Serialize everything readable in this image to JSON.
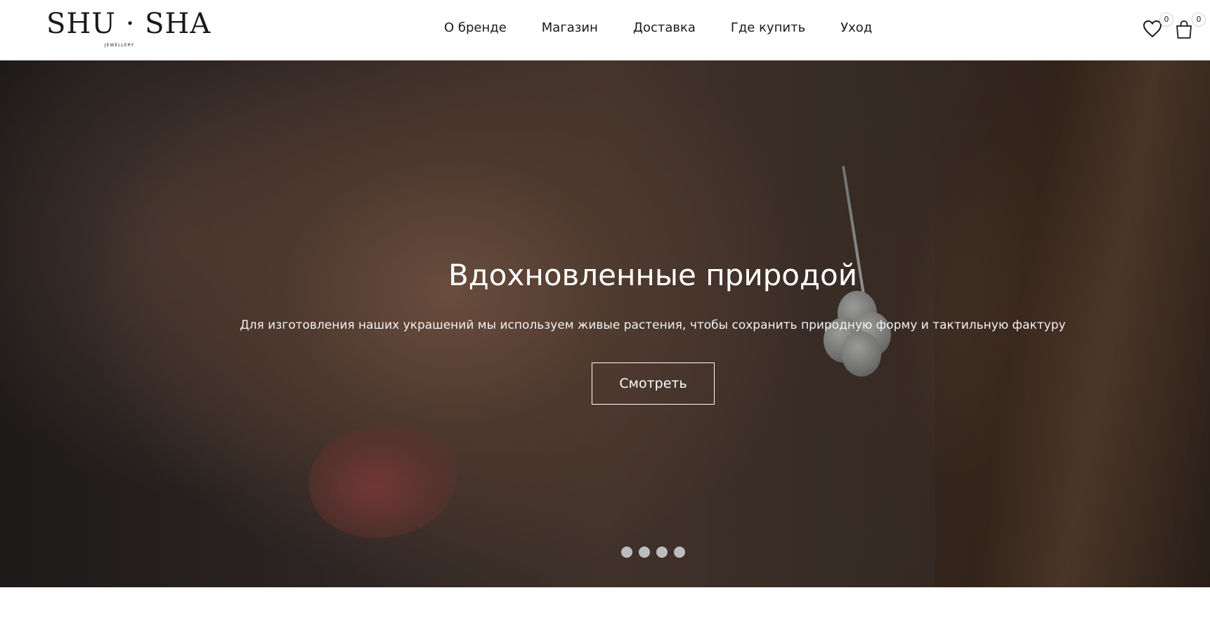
{
  "header": {
    "logo": {
      "main": "SHU · SHA",
      "sub": "JEWELLERY"
    },
    "nav": [
      {
        "label": "О бренде"
      },
      {
        "label": "Магазин"
      },
      {
        "label": "Доставка"
      },
      {
        "label": "Где купить"
      },
      {
        "label": "Уход"
      }
    ],
    "wishlist": {
      "icon": "heart-icon",
      "count": "0"
    },
    "cart": {
      "icon": "shopping-bag-icon",
      "count": "0"
    }
  },
  "hero": {
    "title": "Вдохновленные природой",
    "subtitle": "Для изготовления наших украшений мы используем живые растения, чтобы сохранить природную форму и тактильную фактуру",
    "button_label": "Смотреть",
    "slides_count": 4,
    "active_slide": 1
  },
  "colors": {
    "text": "#1a1a1a",
    "hero_text": "#ffffff",
    "dot": "#bdbdbd"
  }
}
